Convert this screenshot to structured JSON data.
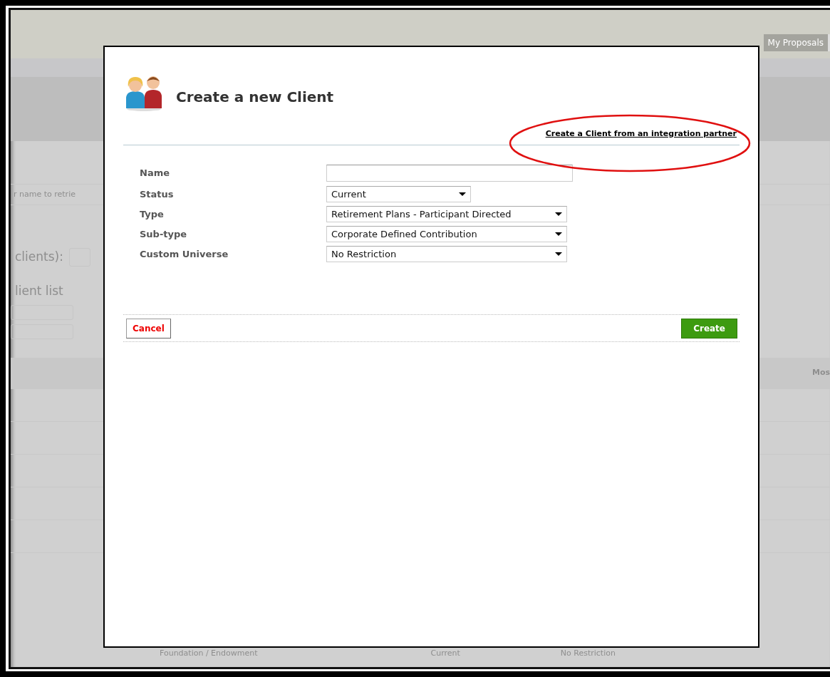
{
  "background": {
    "nav_tab": "My Proposals",
    "search_hint": "r name to retrie",
    "clients_label": "clients):",
    "list_heading": "lient list",
    "column_header": "Mos",
    "last_row": [
      "Foundation / Endowment",
      "Current",
      "No Restriction"
    ]
  },
  "dialog": {
    "title": "Create a new Client",
    "link": "Create a Client from an integration partner",
    "link_highlighted": true,
    "fields": [
      {
        "label": "Name",
        "kind": "text"
      },
      {
        "label": "Status",
        "kind": "select",
        "value": "Current"
      },
      {
        "label": "Type",
        "kind": "select",
        "value": "Retirement Plans - Participant Directed"
      },
      {
        "label": "Sub-type",
        "kind": "select",
        "value": "Corporate Defined Contribution"
      },
      {
        "label": "Custom Universe",
        "kind": "select",
        "value": "No Restriction"
      }
    ],
    "buttons": [
      {
        "label": "Cancel",
        "kind": "cancel"
      },
      {
        "label": "Create",
        "kind": "primary"
      }
    ]
  }
}
